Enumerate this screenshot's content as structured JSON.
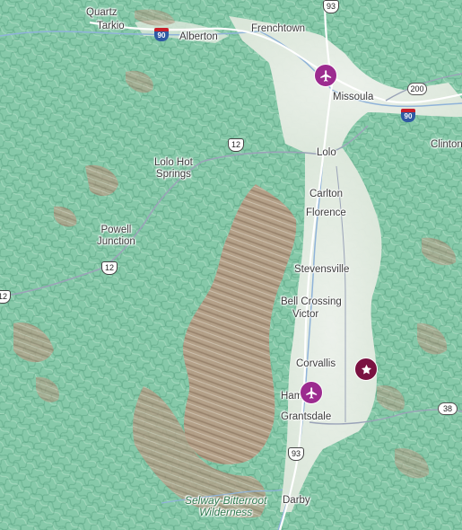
{
  "map": {
    "places": [
      {
        "id": "quartz",
        "name": "Quartz"
      },
      {
        "id": "tarkio",
        "name": "Tarkio"
      },
      {
        "id": "alberton",
        "name": "Alberton"
      },
      {
        "id": "frenchtown",
        "name": "Frenchtown"
      },
      {
        "id": "missoula",
        "name": "Missoula"
      },
      {
        "id": "clinton",
        "name": "Clinton"
      },
      {
        "id": "lolo",
        "name": "Lolo"
      },
      {
        "id": "lolo-hot-springs",
        "name": "Lolo Hot\nSprings"
      },
      {
        "id": "carlton",
        "name": "Carlton"
      },
      {
        "id": "florence",
        "name": "Florence"
      },
      {
        "id": "powell-junction",
        "name": "Powell\nJunction"
      },
      {
        "id": "stevensville",
        "name": "Stevensville"
      },
      {
        "id": "bell-crossing",
        "name": "Bell Crossing"
      },
      {
        "id": "victor",
        "name": "Victor"
      },
      {
        "id": "corvallis",
        "name": "Corvallis"
      },
      {
        "id": "hamilton",
        "name": "Ham"
      },
      {
        "id": "grantsdale",
        "name": "Grantsdale"
      },
      {
        "id": "darby",
        "name": "Darby"
      }
    ],
    "wilderness": "Selway-Bitterroot\nWilderness",
    "shields": [
      {
        "id": "i90-west",
        "type": "interstate",
        "number": "90"
      },
      {
        "id": "i90-east",
        "type": "interstate",
        "number": "90"
      },
      {
        "id": "us93-north",
        "type": "us",
        "number": "93"
      },
      {
        "id": "us93-south",
        "type": "us",
        "number": "93"
      },
      {
        "id": "us12-lolo",
        "type": "us",
        "number": "12"
      },
      {
        "id": "us12-powell",
        "type": "us",
        "number": "12"
      },
      {
        "id": "us12-west",
        "type": "us",
        "number": "12"
      },
      {
        "id": "mt200",
        "type": "state",
        "number": "200"
      },
      {
        "id": "mt38",
        "type": "state",
        "number": "38"
      }
    ],
    "pois": [
      {
        "id": "missoula-airport",
        "kind": "airport",
        "icon": "airplane-icon"
      },
      {
        "id": "hamilton-airport",
        "kind": "airport",
        "icon": "airplane-icon"
      },
      {
        "id": "corvallis-landmark",
        "kind": "landmark",
        "icon": "star-icon"
      }
    ],
    "colors": {
      "forest": "#86c9a9",
      "valley": "#e9eee4",
      "mountain": "#b79c85",
      "road": "#9aa3b8",
      "highway": "#ffffff",
      "airport": "#9c2b8f",
      "landmark": "#7a1241"
    }
  }
}
